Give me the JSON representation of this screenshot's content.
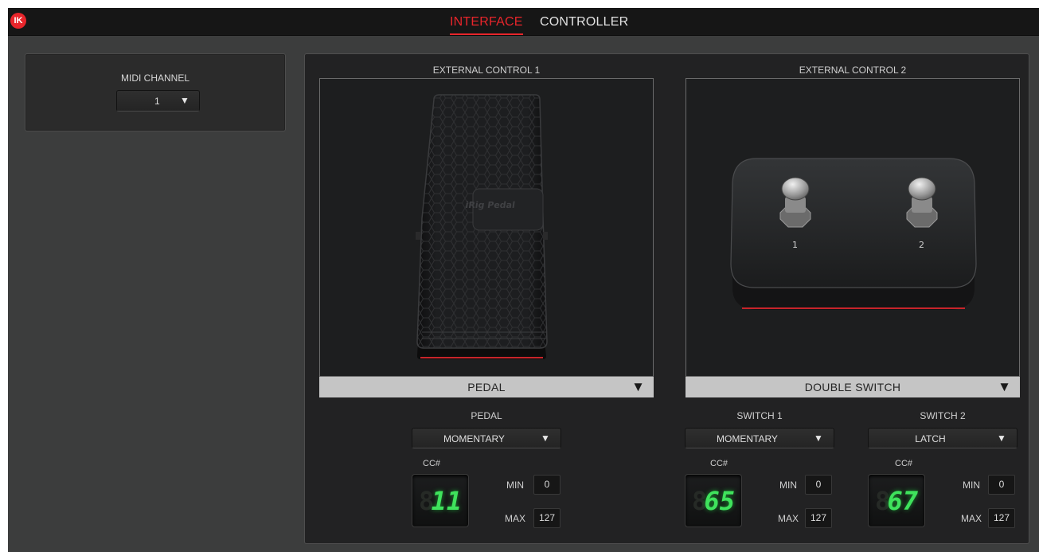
{
  "app": {
    "logo_text": "IK",
    "brand_color": "#e8252b"
  },
  "tabs": [
    {
      "label": "INTERFACE",
      "active": true
    },
    {
      "label": "CONTROLLER",
      "active": false
    }
  ],
  "midi": {
    "label": "MIDI CHANNEL",
    "value": "1"
  },
  "external_controls": [
    {
      "title": "EXTERNAL CONTROL 1",
      "device": "PEDAL",
      "device_brand": "iRig Pedal",
      "settings": [
        {
          "title": "PEDAL",
          "mode": "MOMENTARY",
          "cc_label": "CC#",
          "cc": "11",
          "min_label": "MIN",
          "min": "0",
          "max_label": "MAX",
          "max": "127"
        }
      ]
    },
    {
      "title": "EXTERNAL CONTROL 2",
      "device": "DOUBLE SWITCH",
      "switch_labels": [
        "1",
        "2"
      ],
      "settings": [
        {
          "title": "SWITCH 1",
          "mode": "MOMENTARY",
          "cc_label": "CC#",
          "cc": "65",
          "min_label": "MIN",
          "min": "0",
          "max_label": "MAX",
          "max": "127"
        },
        {
          "title": "SWITCH 2",
          "mode": "LATCH",
          "cc_label": "CC#",
          "cc": "67",
          "min_label": "MIN",
          "min": "0",
          "max_label": "MAX",
          "max": "127"
        }
      ]
    }
  ],
  "icons": {
    "dropdown_arrow": "▼",
    "lcd_ghost": "8"
  },
  "colors": {
    "lcd_green": "#3fe25c",
    "accent_red": "#e8252b",
    "select_bar": "#c5c5c5"
  }
}
